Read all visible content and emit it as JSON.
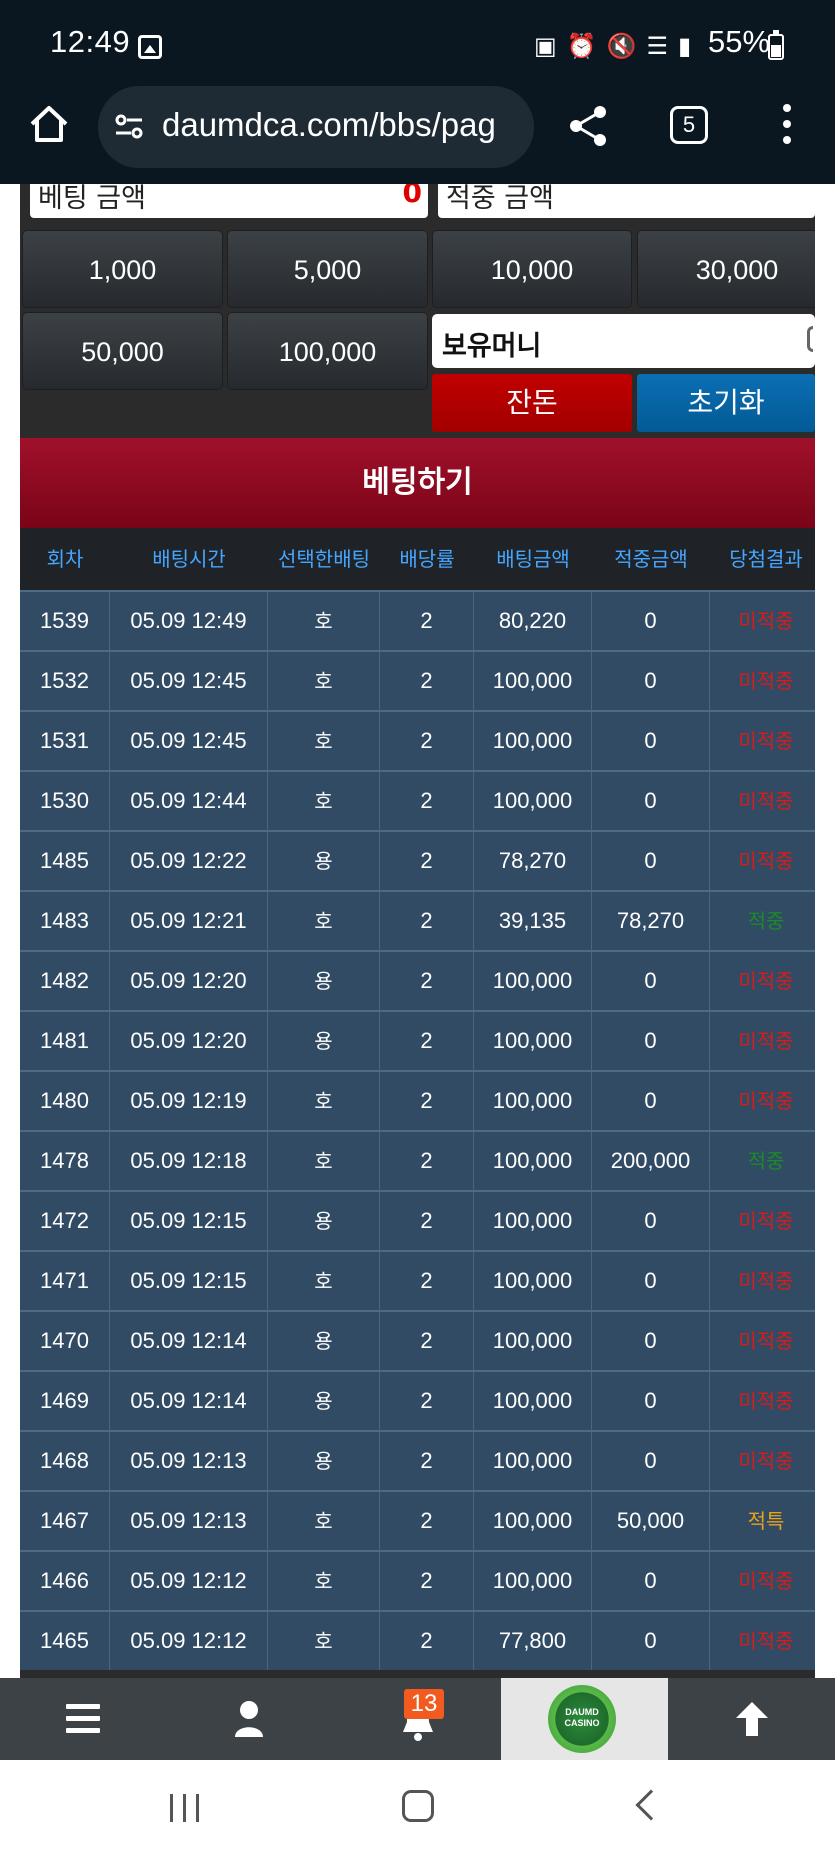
{
  "status_bar": {
    "time": "12:49",
    "battery": "55%",
    "icons": [
      "image-icon",
      "lock-icon",
      "alarm-icon",
      "mute-icon",
      "wifi-icon",
      "signal-icon",
      "battery-icon"
    ]
  },
  "browser": {
    "url": "daumdca.com/bbs/pag",
    "tab_count": "5"
  },
  "bet_form": {
    "bet_amount_label": "베팅 금액",
    "bet_amount_value": "0",
    "win_amount_label": "적중 금액",
    "chips": [
      "1,000",
      "5,000",
      "10,000",
      "30,000",
      "50,000",
      "100,000"
    ],
    "holding_label": "보유머니",
    "change_button": "잔돈",
    "reset_button": "초기화",
    "bet_button": "베팅하기"
  },
  "table": {
    "headers": [
      "회차",
      "배팅시간",
      "선택한배팅",
      "배당률",
      "배팅금액",
      "적중금액",
      "당첨결과"
    ],
    "rows": [
      {
        "round": "1539",
        "time": "05.09 12:49",
        "pick": "호",
        "odds": "2",
        "bet": "80,220",
        "win": "0",
        "result": "미적중",
        "status": "lose"
      },
      {
        "round": "1532",
        "time": "05.09 12:45",
        "pick": "호",
        "odds": "2",
        "bet": "100,000",
        "win": "0",
        "result": "미적중",
        "status": "lose"
      },
      {
        "round": "1531",
        "time": "05.09 12:45",
        "pick": "호",
        "odds": "2",
        "bet": "100,000",
        "win": "0",
        "result": "미적중",
        "status": "lose"
      },
      {
        "round": "1530",
        "time": "05.09 12:44",
        "pick": "호",
        "odds": "2",
        "bet": "100,000",
        "win": "0",
        "result": "미적중",
        "status": "lose"
      },
      {
        "round": "1485",
        "time": "05.09 12:22",
        "pick": "용",
        "odds": "2",
        "bet": "78,270",
        "win": "0",
        "result": "미적중",
        "status": "lose"
      },
      {
        "round": "1483",
        "time": "05.09 12:21",
        "pick": "호",
        "odds": "2",
        "bet": "39,135",
        "win": "78,270",
        "result": "적중",
        "status": "win"
      },
      {
        "round": "1482",
        "time": "05.09 12:20",
        "pick": "용",
        "odds": "2",
        "bet": "100,000",
        "win": "0",
        "result": "미적중",
        "status": "lose"
      },
      {
        "round": "1481",
        "time": "05.09 12:20",
        "pick": "용",
        "odds": "2",
        "bet": "100,000",
        "win": "0",
        "result": "미적중",
        "status": "lose"
      },
      {
        "round": "1480",
        "time": "05.09 12:19",
        "pick": "호",
        "odds": "2",
        "bet": "100,000",
        "win": "0",
        "result": "미적중",
        "status": "lose"
      },
      {
        "round": "1478",
        "time": "05.09 12:18",
        "pick": "호",
        "odds": "2",
        "bet": "100,000",
        "win": "200,000",
        "result": "적중",
        "status": "win"
      },
      {
        "round": "1472",
        "time": "05.09 12:15",
        "pick": "용",
        "odds": "2",
        "bet": "100,000",
        "win": "0",
        "result": "미적중",
        "status": "lose"
      },
      {
        "round": "1471",
        "time": "05.09 12:15",
        "pick": "호",
        "odds": "2",
        "bet": "100,000",
        "win": "0",
        "result": "미적중",
        "status": "lose"
      },
      {
        "round": "1470",
        "time": "05.09 12:14",
        "pick": "용",
        "odds": "2",
        "bet": "100,000",
        "win": "0",
        "result": "미적중",
        "status": "lose"
      },
      {
        "round": "1469",
        "time": "05.09 12:14",
        "pick": "용",
        "odds": "2",
        "bet": "100,000",
        "win": "0",
        "result": "미적중",
        "status": "lose"
      },
      {
        "round": "1468",
        "time": "05.09 12:13",
        "pick": "용",
        "odds": "2",
        "bet": "100,000",
        "win": "0",
        "result": "미적중",
        "status": "lose"
      },
      {
        "round": "1467",
        "time": "05.09 12:13",
        "pick": "호",
        "odds": "2",
        "bet": "100,000",
        "win": "50,000",
        "result": "적특",
        "status": "special"
      },
      {
        "round": "1466",
        "time": "05.09 12:12",
        "pick": "호",
        "odds": "2",
        "bet": "100,000",
        "win": "0",
        "result": "미적중",
        "status": "lose"
      },
      {
        "round": "1465",
        "time": "05.09 12:12",
        "pick": "호",
        "odds": "2",
        "bet": "77,800",
        "win": "0",
        "result": "미적중",
        "status": "lose"
      }
    ]
  },
  "bottom_nav": {
    "notification_count": "13",
    "logo_text": "DAUMD CASINO"
  },
  "colors": {
    "lose": "#d81b1b",
    "win": "#1b8a2a",
    "special": "#e8a21a",
    "header_text": "#45a6ff",
    "bet_bar": "#8e0a22",
    "row_bg": "#324b64"
  }
}
